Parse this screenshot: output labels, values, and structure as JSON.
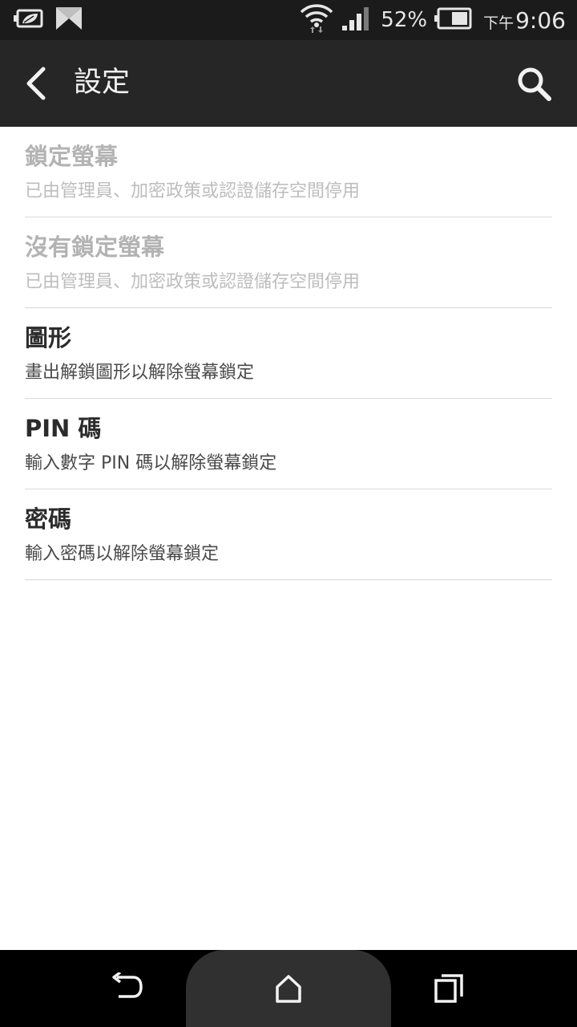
{
  "status_bar": {
    "battery_percent": "52%",
    "time_period": "下午",
    "time": "9:06",
    "icons": [
      "battery-saver-icon",
      "htc-app-icon",
      "wifi-icon",
      "signal-icon",
      "battery-icon"
    ]
  },
  "action_bar": {
    "title": "設定",
    "back_icon": "chevron-left-icon",
    "search_icon": "search-icon"
  },
  "options": [
    {
      "title": "鎖定螢幕",
      "subtitle": "已由管理員、加密政策或認證儲存空間停用",
      "enabled": false
    },
    {
      "title": "沒有鎖定螢幕",
      "subtitle": "已由管理員、加密政策或認證儲存空間停用",
      "enabled": false
    },
    {
      "title": "圖形",
      "subtitle": "畫出解鎖圖形以解除螢幕鎖定",
      "enabled": true
    },
    {
      "title": "PIN 碼",
      "subtitle": "輸入數字 PIN 碼以解除螢幕鎖定",
      "enabled": true
    },
    {
      "title": "密碼",
      "subtitle": "輸入密碼以解除螢幕鎖定",
      "enabled": true
    }
  ],
  "nav_bar": {
    "icons": [
      "back-arrow-icon",
      "home-icon",
      "recent-apps-icon"
    ]
  },
  "colors": {
    "status_bar_bg": "#1b1b1b",
    "action_bar_bg": "#262626",
    "list_bg": "#ffffff",
    "disabled_text": "#b3b3b3",
    "nav_bar_bg": "#000000"
  }
}
